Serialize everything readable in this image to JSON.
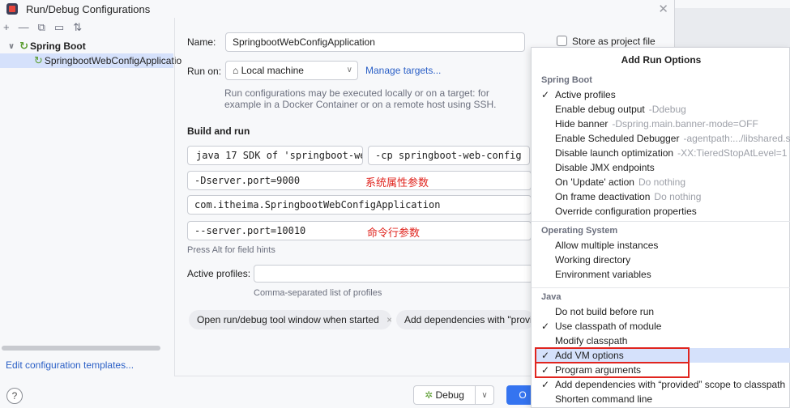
{
  "window": {
    "title": "Run/Debug Configurations"
  },
  "tree": {
    "group_label": "Spring Boot",
    "item_label": "SpringbootWebConfigApplicatio"
  },
  "left": {
    "edit_templates": "Edit configuration templates..."
  },
  "form": {
    "name_label": "Name:",
    "name_value": "SpringbootWebConfigApplication",
    "store_label": "Store as project file",
    "run_on_label": "Run on:",
    "run_on_value": "Local machine",
    "manage_targets": "Manage targets...",
    "run_on_hint": "Run configurations may be executed locally or on a target: for example in a Docker Container or on a remote host using SSH.",
    "build_run": "Build and run",
    "jdk_value": "java 17 SDK of 'springboot-we",
    "cp_value": "-cp springboot-web-config",
    "vm_value": "-Dserver.port=9000",
    "vm_note": "系统属性参数",
    "main_class": "com.itheima.SpringbootWebConfigApplication",
    "args_value": "--server.port=10010",
    "args_note": "命令行参数",
    "alt_hint": "Press Alt for field hints",
    "profiles_label": "Active profiles:",
    "profiles_hint": "Comma-separated list of profiles",
    "chip_tool": "Open run/debug tool window when started",
    "chip_deps": "Add dependencies with \"provid",
    "debug_label": "Debug",
    "ok_label": "O"
  },
  "popup": {
    "title": "Add Run Options",
    "groups": [
      {
        "head": "Spring Boot",
        "items": [
          {
            "check": "✓",
            "label": "Active profiles",
            "hint": ""
          },
          {
            "check": "",
            "label": "Enable debug output",
            "hint": "-Ddebug"
          },
          {
            "check": "",
            "label": "Hide banner",
            "hint": "-Dspring.main.banner-mode=OFF"
          },
          {
            "check": "",
            "label": "Enable Scheduled Debugger",
            "hint": "-agentpath:.../libshared.so"
          },
          {
            "check": "",
            "label": "Disable launch optimization",
            "hint": "-XX:TieredStopAtLevel=1"
          },
          {
            "check": "",
            "label": "Disable JMX endpoints",
            "hint": ""
          },
          {
            "check": "",
            "label": "On 'Update' action",
            "hint": "Do nothing"
          },
          {
            "check": "",
            "label": "On frame deactivation",
            "hint": "Do nothing"
          },
          {
            "check": "",
            "label": "Override configuration properties",
            "hint": ""
          }
        ]
      },
      {
        "head": "Operating System",
        "items": [
          {
            "check": "",
            "label": "Allow multiple instances",
            "hint": ""
          },
          {
            "check": "",
            "label": "Working directory",
            "hint": ""
          },
          {
            "check": "",
            "label": "Environment variables",
            "hint": ""
          }
        ]
      },
      {
        "head": "Java",
        "items": [
          {
            "check": "",
            "label": "Do not build before run",
            "hint": ""
          },
          {
            "check": "✓",
            "label": "Use classpath of module",
            "hint": ""
          },
          {
            "check": "",
            "label": "Modify classpath",
            "hint": ""
          },
          {
            "check": "✓",
            "label": "Add VM options",
            "hint": ""
          },
          {
            "check": "✓",
            "label": "Program arguments",
            "hint": ""
          },
          {
            "check": "✓",
            "label": "Add dependencies with “provided” scope to classpath",
            "hint": ""
          },
          {
            "check": "",
            "label": "Shorten command line",
            "hint": ""
          }
        ]
      }
    ]
  }
}
